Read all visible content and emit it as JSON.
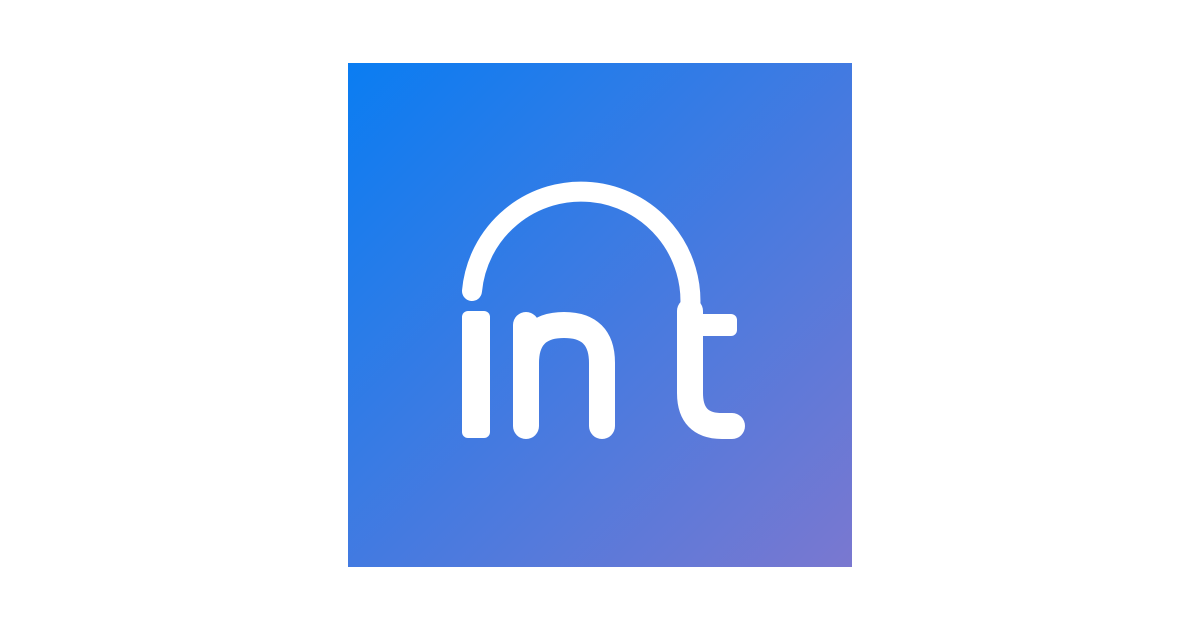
{
  "logo": {
    "text": "int",
    "icon": "int-wordmark-icon",
    "colors": {
      "gradient_start": "#0A7DF2",
      "gradient_end": "#7A78D0",
      "glyph": "#FFFFFF",
      "background": "#FFFFFF"
    }
  }
}
